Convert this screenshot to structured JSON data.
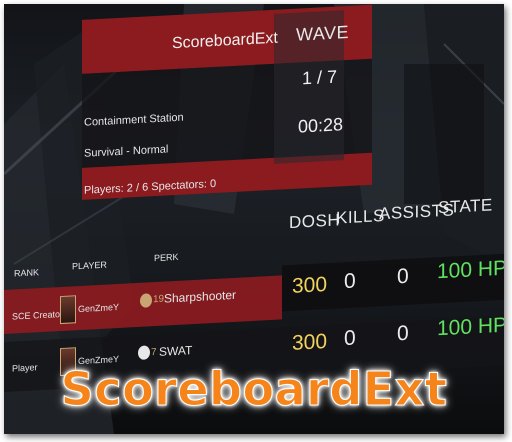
{
  "header": {
    "mod_name": "ScoreboardExt",
    "wave_label": "WAVE",
    "wave_value": "1 / 7",
    "map": "Containment Station",
    "mode": "Survival - Normal",
    "time": "00:28",
    "players": "Players: 2 / 6   Spectators: 0"
  },
  "columns": {
    "rank": "RANK",
    "player": "PLAYER",
    "perk": "PERK",
    "dosh": "DOSH",
    "kills": "KILLS",
    "assists": "ASSISTS",
    "state": "STATE"
  },
  "rows": [
    {
      "rank": "SCE Creator",
      "player": "GenZmeY",
      "perk_level": "19",
      "perk": "Sharpshooter",
      "dosh": "300",
      "kills": "0",
      "assists": "0",
      "state": "100 HP"
    },
    {
      "rank": "Player",
      "player": "GenZmeY",
      "perk_level": "7",
      "perk": "SWAT",
      "dosh": "300",
      "kills": "0",
      "assists": "0",
      "state": "100 HP"
    }
  ],
  "banner_title": "ScoreboardExt",
  "colors": {
    "panel_red": "#8c1b1f",
    "dosh": "#f2d45a",
    "hp": "#5fe25f",
    "title_orange": "#f5851b"
  }
}
